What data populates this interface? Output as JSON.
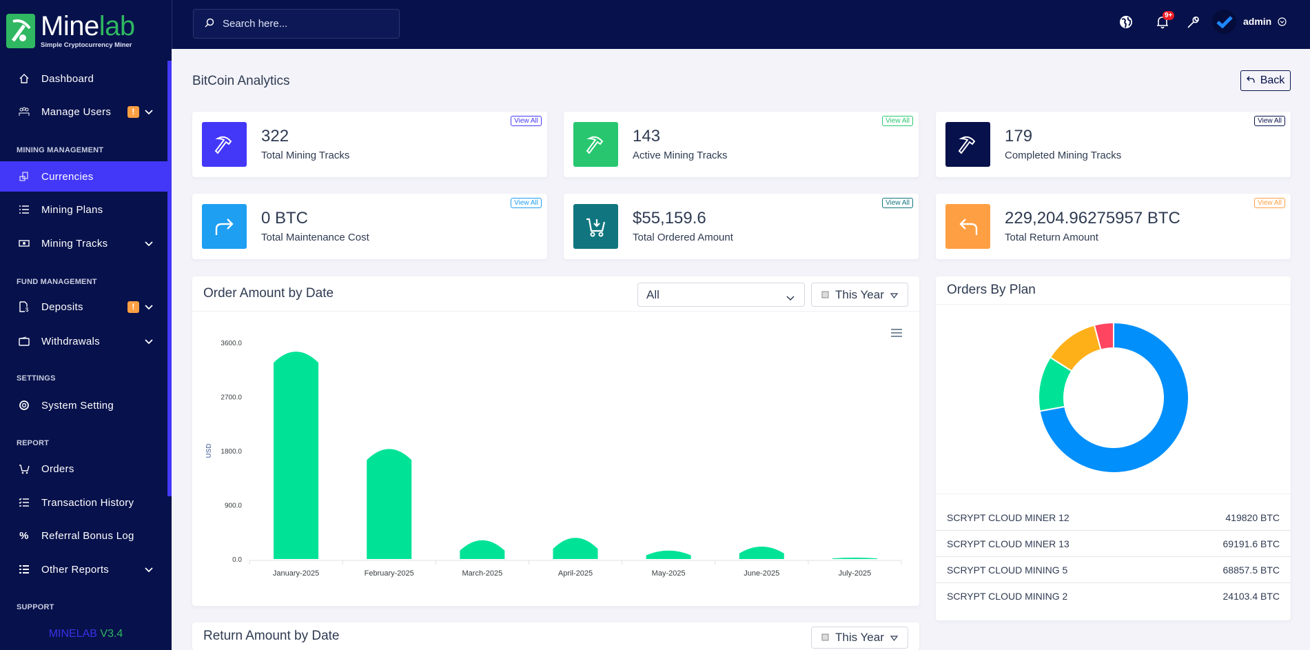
{
  "brand": {
    "name_a": "Mine",
    "name_b": "lab",
    "tagline": "Simple Cryptocurrency Miner",
    "version_a": "MINELAB",
    "version_b": "V3.4"
  },
  "search": {
    "placeholder": "Search here..."
  },
  "topbar": {
    "notif_count": "9+",
    "user": "admin"
  },
  "sidebar": {
    "dashboard": "Dashboard",
    "manage_users": "Manage Users",
    "badge": "!",
    "mining_management": "MINING MANAGEMENT",
    "currencies": "Currencies",
    "mining_plans": "Mining Plans",
    "mining_tracks": "Mining Tracks",
    "fund_management": "FUND MANAGEMENT",
    "deposits": "Deposits",
    "withdrawals": "Withdrawals",
    "settings": "SETTINGS",
    "system_setting": "System Setting",
    "report": "REPORT",
    "orders": "Orders",
    "transaction_history": "Transaction History",
    "referral_bonus_log": "Referral Bonus Log",
    "other_reports": "Other Reports",
    "support": "SUPPORT"
  },
  "page": {
    "title": "BitCoin Analytics",
    "back": "Back"
  },
  "stats": [
    {
      "value": "322",
      "label": "Total Mining Tracks",
      "view_all": "View All",
      "color": "#4338f7"
    },
    {
      "value": "143",
      "label": "Active Mining Tracks",
      "view_all": "View All",
      "color": "#28c76f"
    },
    {
      "value": "179",
      "label": "Completed Mining Tracks",
      "view_all": "View All",
      "color": "#07114b"
    },
    {
      "value": "0 BTC",
      "label": "Total Maintenance Cost",
      "view_all": "View All",
      "color": "#1e9ff2"
    },
    {
      "value": "$55,159.6",
      "label": "Total Ordered Amount",
      "view_all": "View All",
      "color": "#10757e"
    },
    {
      "value": "229,204.96275957 BTC",
      "label": "Total Return Amount",
      "view_all": "View All",
      "color": "#ff9f43"
    }
  ],
  "order_chart": {
    "title": "Order Amount by Date",
    "filter": "All",
    "period": "This Year"
  },
  "return_chart": {
    "title": "Return Amount by Date",
    "period": "This Year"
  },
  "plans": {
    "title": "Orders By Plan",
    "rows": [
      {
        "name": "SCRYPT CLOUD MINER 12",
        "amount": "419820 BTC"
      },
      {
        "name": "SCRYPT CLOUD MINER 13",
        "amount": "69191.6 BTC"
      },
      {
        "name": "SCRYPT CLOUD MINING 5",
        "amount": "68857.5 BTC"
      },
      {
        "name": "SCRYPT CLOUD MINING 2",
        "amount": "24103.4 BTC"
      }
    ]
  },
  "chart_data": [
    {
      "type": "bar",
      "title": "Order Amount by Date",
      "ylabel": "USD",
      "xlabel": "",
      "ylim": [
        0,
        3600
      ],
      "yticks": [
        "0.0",
        "900.0",
        "1800.0",
        "2700.0",
        "3600.0"
      ],
      "categories": [
        "January-2025",
        "February-2025",
        "March-2025",
        "April-2025",
        "May-2025",
        "June-2025",
        "July-2025"
      ],
      "values": [
        3450,
        1830,
        313,
        352,
        141,
        206,
        23
      ],
      "color": "#00e396"
    },
    {
      "type": "pie",
      "title": "Orders By Plan",
      "labels": [
        "SCRYPT CLOUD MINER 12",
        "SCRYPT CLOUD MINER 13",
        "SCRYPT CLOUD MINING 5",
        "SCRYPT CLOUD MINING 2"
      ],
      "values": [
        419820,
        69191.6,
        68857.5,
        24103.4
      ],
      "colors": [
        "#008ffb",
        "#00e396",
        "#feb019",
        "#ff4560"
      ]
    }
  ]
}
